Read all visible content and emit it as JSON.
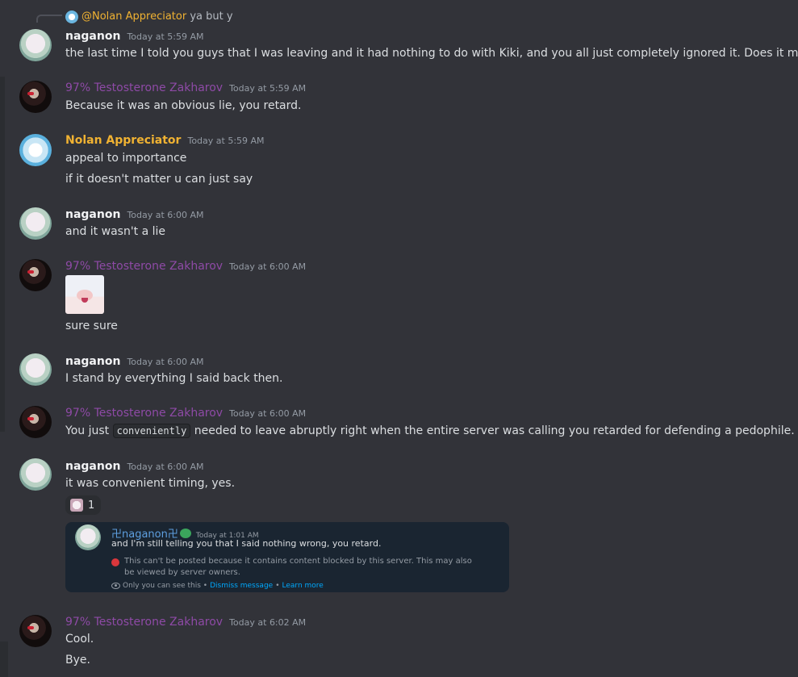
{
  "reply": {
    "name": "@Nolan Appreciator",
    "text": "ya but y"
  },
  "messages": [
    {
      "id": "m1",
      "author": "naganon",
      "timestamp": "Today at 5:59 AM",
      "lines": [
        "the last time I told you guys that I was leaving and it had nothing to do with Kiki, and you all just completely ignored it. Does it matter?"
      ]
    },
    {
      "id": "m2",
      "author": "97% Testosterone Zakharov",
      "timestamp": "Today at 5:59 AM",
      "lines": [
        "Because it was an obvious lie, you retard."
      ]
    },
    {
      "id": "m3",
      "author": "Nolan Appreciator",
      "timestamp": "Today at 5:59 AM",
      "lines": [
        "appeal to importance",
        "if it doesn't matter u can just say"
      ]
    },
    {
      "id": "m4",
      "author": "naganon",
      "timestamp": "Today at 6:00 AM",
      "lines": [
        "and it wasn't a lie"
      ]
    },
    {
      "id": "m5",
      "author": "97% Testosterone Zakharov",
      "timestamp": "Today at 6:00 AM",
      "lines": [
        "sure sure"
      ]
    },
    {
      "id": "m6",
      "author": "naganon",
      "timestamp": "Today at 6:00 AM",
      "lines": [
        "I stand by everything I said back then."
      ]
    },
    {
      "id": "m7",
      "author": "97% Testosterone Zakharov",
      "timestamp": "Today at 6:00 AM",
      "text_before": "You just",
      "code": "conveniently",
      "text_after": "needed to leave abruptly right when the entire server was calling you retarded for defending a pedophile."
    },
    {
      "id": "m8",
      "author": "naganon",
      "timestamp": "Today at 6:00 AM",
      "lines": [
        "it was convenient timing, yes."
      ]
    },
    {
      "id": "m9",
      "author": "97% Testosterone Zakharov",
      "timestamp": "Today at 6:02 AM",
      "lines": [
        "Cool.",
        "Bye."
      ]
    }
  ],
  "reaction": {
    "count": "1"
  },
  "embed": {
    "author": "卍naganon卍",
    "timestamp": "Today at 1:01 AM",
    "text": "and I'm still telling you that I said nothing wrong, you retard.",
    "blocked_text": "This can't be posted because it contains content blocked by this server. This may also be viewed by server owners.",
    "only_you": "Only you can see this •",
    "dismiss": "Dismiss message",
    "sep": "•",
    "learn_more": "Learn more"
  },
  "colors": {
    "background": "#323339",
    "zakharov_name": "#8e4aa6",
    "nolan_name": "#f0b232",
    "link": "#00a8fc"
  }
}
